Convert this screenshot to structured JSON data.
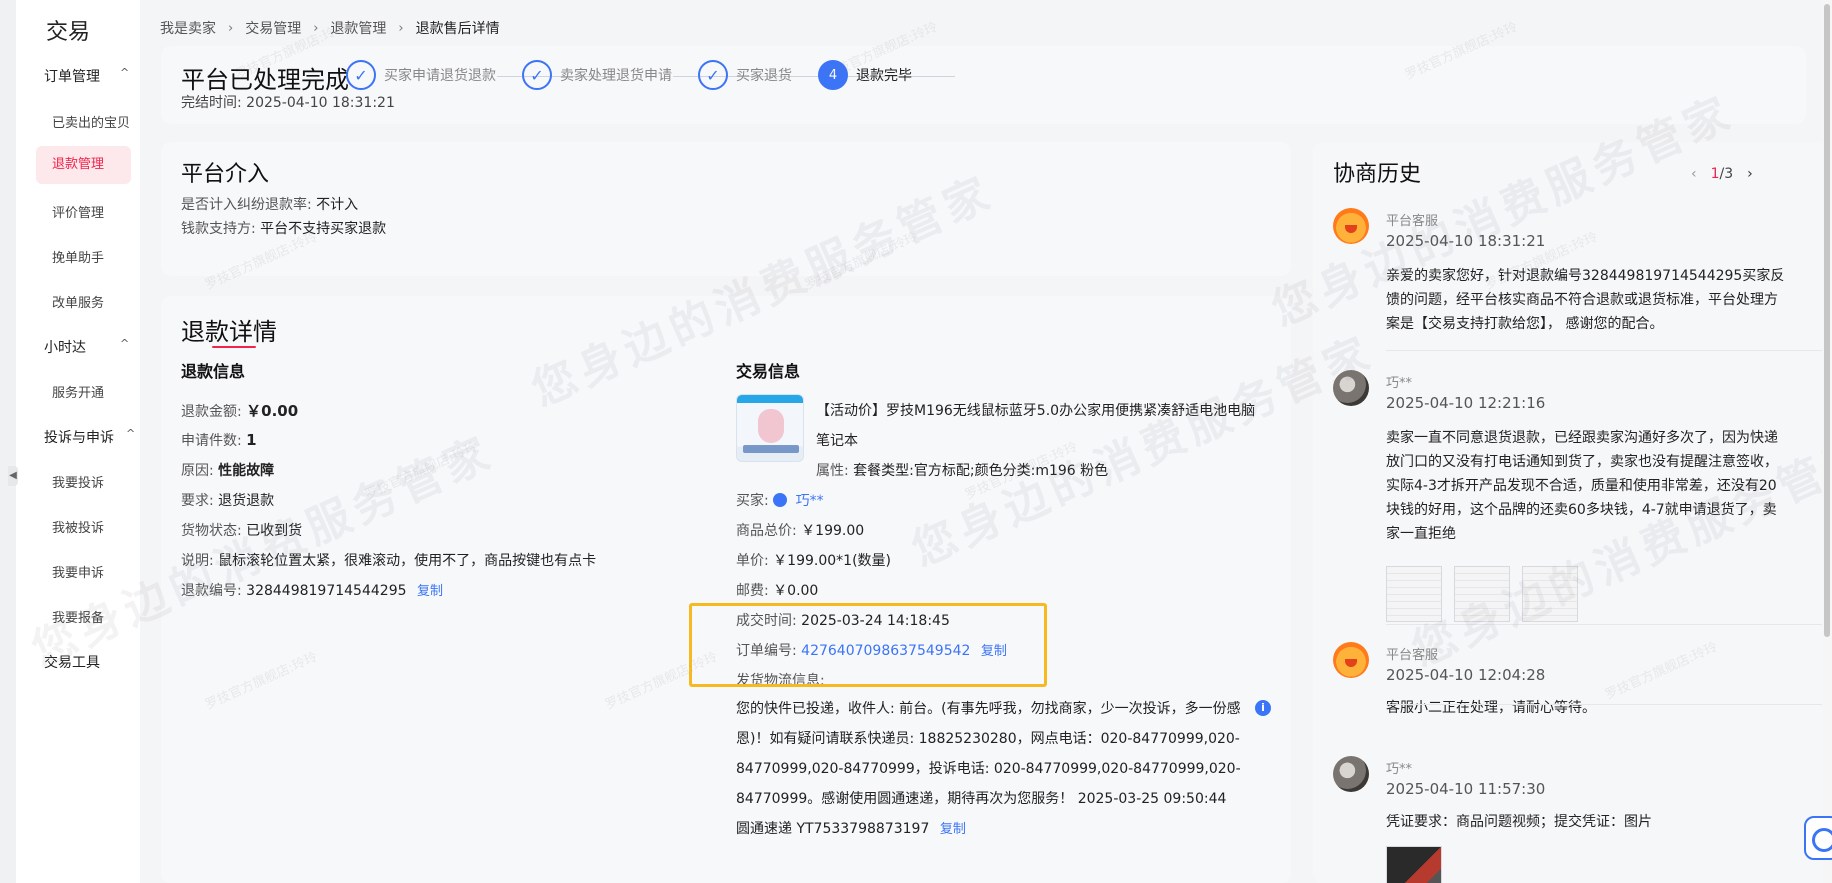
{
  "sidebar": {
    "title": "交易",
    "groups": [
      {
        "label": "订单管理",
        "caret": "^",
        "items": [
          {
            "label": "已卖出的宝贝"
          },
          {
            "label": "退款管理",
            "active": true
          },
          {
            "label": "评价管理"
          },
          {
            "label": "挽单助手"
          },
          {
            "label": "改单服务"
          }
        ]
      },
      {
        "label": "小时达",
        "caret": "^",
        "items": [
          {
            "label": "服务开通"
          }
        ]
      },
      {
        "label": "投诉与申诉",
        "caret": "^",
        "items": [
          {
            "label": "我要投诉"
          },
          {
            "label": "我被投诉"
          },
          {
            "label": "我要申诉"
          },
          {
            "label": "我要报备"
          }
        ]
      },
      {
        "label": "交易工具"
      }
    ],
    "collapse_glyph": "◀"
  },
  "breadcrumb": [
    "我是卖家",
    "交易管理",
    "退款管理",
    "退款售后详情"
  ],
  "breadcrumb_sep": "›",
  "status": {
    "title": "平台已处理完成",
    "time_label": "完结时间:",
    "time_value": "2025-04-10 18:31:21",
    "steps": [
      {
        "label": "买家申请退货退款",
        "mark": "✓"
      },
      {
        "label": "卖家处理退货申请",
        "mark": "✓"
      },
      {
        "label": "买家退货",
        "mark": "✓"
      },
      {
        "label": "退款完毕",
        "mark": "4"
      }
    ]
  },
  "platform": {
    "title": "平台介入",
    "dispute_rate_label": "是否计入纠纷退款率:",
    "dispute_rate_value": "不计入",
    "funding_label": "钱款支持方:",
    "funding_value": "平台不支持买家退款"
  },
  "refund_detail": {
    "title": "退款详情",
    "refund_info": {
      "heading": "退款信息",
      "amount_label": "退款金额:",
      "amount_value": "￥0.00",
      "count_label": "申请件数:",
      "count_value": "1",
      "reason_label": "原因:",
      "reason_value": "性能故障",
      "request_label": "要求:",
      "request_value": "退货退款",
      "goods_status_label": "货物状态:",
      "goods_status_value": "已收到货",
      "desc_label": "说明:",
      "desc_value": "鼠标滚轮位置太紧，很难滚动，使用不了，商品按键也有点卡",
      "refund_no_label": "退款编号:",
      "refund_no_value": "328449819714544295",
      "copy": "复制"
    },
    "trade_info": {
      "heading": "交易信息",
      "product_name": "【活动价】罗技M196无线鼠标蓝牙5.0办公家用便携紧凑舒适电池电脑笔记本",
      "attr_label": "属性:",
      "attr_value": "套餐类型:官方标配;颜色分类:m196 粉色",
      "buyer_label": "买家:",
      "buyer_value": "巧**",
      "total_label": "商品总价:",
      "total_value": "￥199.00",
      "unit_label": "单价:",
      "unit_value": "￥199.00*1(数量)",
      "shipping_label": "邮费:",
      "shipping_value": "￥0.00",
      "deal_time_label": "成交时间:",
      "deal_time_value": "2025-03-24 14:18:45",
      "order_no_label": "订单编号:",
      "order_no_value": "4276407098637549542",
      "copy": "复制",
      "logistics_label": "发货物流信息:",
      "logistics_text": "您的快件已投递，收件人: 前台。(有事先呼我，勿找商家，少一次投诉，多一份感恩)！如有疑问请联系快递员: 18825230280，网点电话：020-84770999,020-84770999,020-84770999，投诉电话: 020-84770999,020-84770999,020-84770999。感谢使用圆通速递，期待再次为您服务！ 2025-03-25 09:50:44",
      "tracking_text": "圆通速递 YT7533798873197",
      "info_icon": "i"
    }
  },
  "history": {
    "title": "协商历史",
    "pager": {
      "prev": "‹",
      "current": "1",
      "total": "/3",
      "next": "›"
    },
    "items": [
      {
        "name": "平台客服",
        "time": "2025-04-10 18:31:21",
        "content": "亲爱的卖家您好，针对退款编号328449819714544295买家反馈的问题，经平台核实商品不符合退款或退货标准，平台处理方案是【交易支持打款给您】，   感谢您的配合。"
      },
      {
        "name": "巧**",
        "time": "2025-04-10 12:21:16",
        "content": "卖家一直不同意退货退款，已经跟卖家沟通好多次了，因为快递放门口的又没有打电话通知到货了，卖家也没有提醒注意签收，实际4-3才拆开产品发现不合适，质量和使用非常差，还没有20块钱的好用，这个品牌的还卖60多块钱，4-7就申请退货了，卖家一直拒绝"
      },
      {
        "name": "平台客服",
        "time": "2025-04-10 12:04:28",
        "content": "客服小二正在处理，请耐心等待。"
      },
      {
        "name": "巧**",
        "time": "2025-04-10 11:57:30",
        "content": "凭证要求：商品问题视频；提交凭证：图片"
      }
    ]
  },
  "watermark": {
    "big": "您身边的消费服务管家",
    "small": "罗技官方旗舰店:玲玲"
  },
  "colors": {
    "accent": "#3b74f6",
    "brand_red": "#f2244d",
    "highlight": "#f6b91f"
  }
}
